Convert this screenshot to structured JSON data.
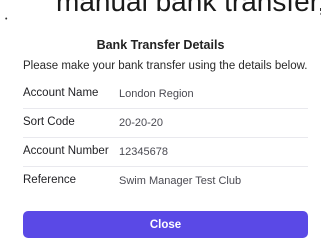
{
  "background": {
    "partial_text": "manual bank transfer,",
    "bullet": "•"
  },
  "modal": {
    "title": "Bank Transfer Details",
    "intro": "Please make your bank transfer using the details below.",
    "details": [
      {
        "label": "Account Name",
        "value": "London Region"
      },
      {
        "label": "Sort Code",
        "value": "20-20-20"
      },
      {
        "label": "Account Number",
        "value": "12345678"
      },
      {
        "label": "Reference",
        "value": "Swim Manager Test Club"
      }
    ],
    "close_label": "Close"
  },
  "colors": {
    "accent": "#5a49e6",
    "divider": "#e9e9ee",
    "background": "#ffffff"
  }
}
